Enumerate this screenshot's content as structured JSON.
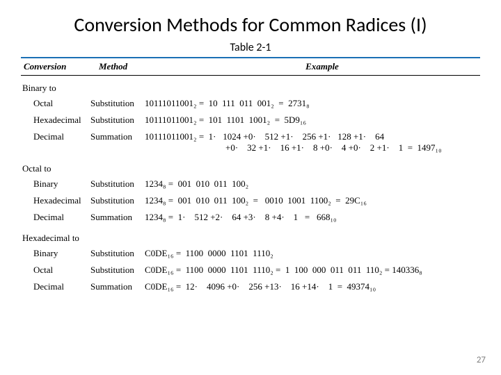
{
  "title": "Conversion Methods for Common Radices (I)",
  "caption": "Table  2-1",
  "columns": {
    "c1": "Conversion",
    "c2": "Method",
    "c3": "Example"
  },
  "groups": [
    {
      "title": "Binary to",
      "rows": [
        {
          "c1": "Octal",
          "c2": "Substitution",
          "c3": "10111011001₂ =  10  111  011  001₂  =  2731₈"
        },
        {
          "c1": "Hexadecimal",
          "c2": "Substitution",
          "c3": "10111011001₂ =  101  1101  1001₂  =  5D9₁₆"
        },
        {
          "c1": "Decimal",
          "c2": "Summation",
          "c3": "10111011001₂ =  1·   1024 +0·    512 +1·    256 +1·   128 +1·    64",
          "c3b": "+0·    32 +1·    16 +1·    8 +0·    4 +0·    2 +1·    1  =  1497₁₀"
        }
      ]
    },
    {
      "title": "Octal to",
      "rows": [
        {
          "c1": "Binary",
          "c2": "Substitution",
          "c3": "1234₈ =  001  010  011  100₂"
        },
        {
          "c1": "Hexadecimal",
          "c2": "Substitution",
          "c3": "1234₈ =  001  010  011  100₂  =   0010  1001  1100₂  =  29C₁₆"
        },
        {
          "c1": "Decimal",
          "c2": "Summation",
          "c3": "1234₈ =  1·    512 +2·    64 +3·    8 +4·    1   =   668₁₀"
        }
      ]
    },
    {
      "title": "Hexadecimal to",
      "rows": [
        {
          "c1": "Binary",
          "c2": "Substitution",
          "c3": "C0DE₁₆ =  1100  0000  1101  1110₂"
        },
        {
          "c1": "Octal",
          "c2": "Substitution",
          "c3": "C0DE₁₆ =  1100  0000  1101  1110₂ =  1  100  000  011  011  110₂ = 140336₈"
        },
        {
          "c1": "Decimal",
          "c2": "Summation",
          "c3": "C0DE₁₆ =  12·    4096 +0·    256 +13·    16 +14·    1  =  49374₁₀"
        }
      ]
    }
  ],
  "pagenum": "27"
}
